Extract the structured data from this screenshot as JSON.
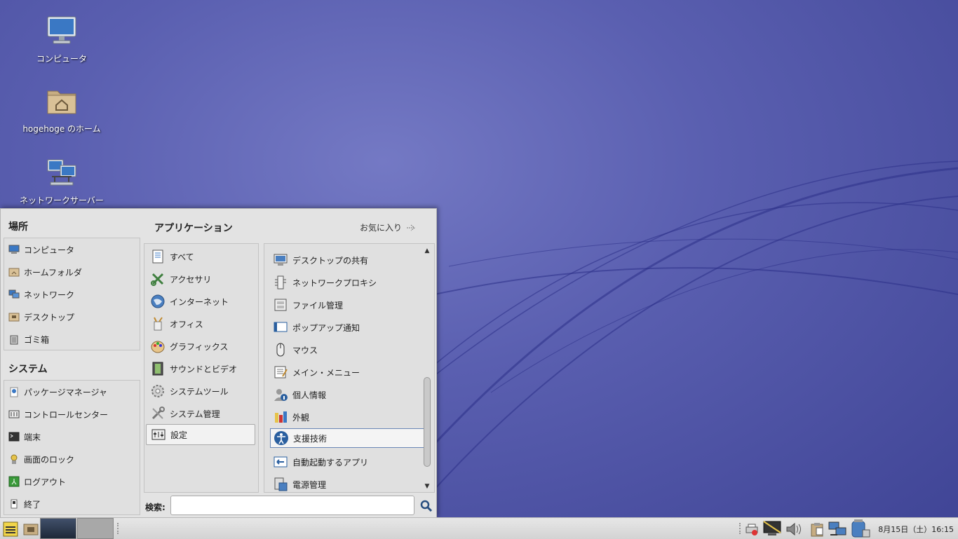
{
  "desktop": {
    "icons": [
      {
        "label": "コンピュータ"
      },
      {
        "label": "hogehoge のホーム"
      },
      {
        "label": "ネットワークサーバー"
      }
    ]
  },
  "menu": {
    "places": {
      "title": "場所",
      "items": [
        "コンピュータ",
        "ホームフォルダ",
        "ネットワーク",
        "デスクトップ",
        "ゴミ箱"
      ]
    },
    "system": {
      "title": "システム",
      "items": [
        "パッケージマネージャ",
        "コントロールセンター",
        "端末",
        "画面のロック",
        "ログアウト",
        "終了"
      ]
    },
    "applications": {
      "title": "アプリケーション",
      "favorites_label": "お気に入り",
      "categories": [
        "すべて",
        "アクセサリ",
        "インターネット",
        "オフィス",
        "グラフィックス",
        "サウンドとビデオ",
        "システムツール",
        "システム管理",
        "設定"
      ],
      "selected_category": "設定",
      "apps": [
        "デスクトップの共有",
        "ネットワークプロキシ",
        "ファイル管理",
        "ポップアップ通知",
        "マウス",
        "メイン・メニュー",
        "個人情報",
        "外観",
        "支援技術",
        "自動起動するアプリ",
        "電源管理"
      ],
      "selected_app": "支援技術"
    },
    "search": {
      "label": "検索:",
      "value": "",
      "placeholder": ""
    }
  },
  "taskbar": {
    "clock": "8月15日（土）16:15"
  },
  "colors": {
    "wallpaper": "#5a5fb0",
    "menu_bg": "#e3e3e3",
    "selection_border": "#6a87b5"
  }
}
